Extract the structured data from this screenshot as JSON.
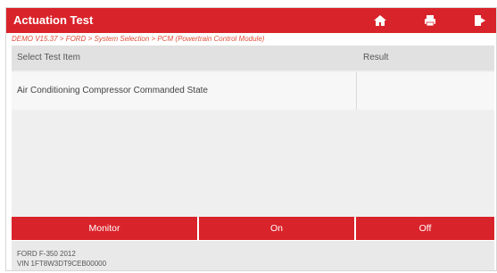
{
  "header": {
    "title": "Actuation Test",
    "icons": [
      "home-icon",
      "printer-icon",
      "exit-icon"
    ]
  },
  "breadcrumb": "DEMO V15.37 > FORD > System Selection > PCM (Powertrain Control Module)",
  "table": {
    "columns": [
      "Select Test Item",
      "Result"
    ],
    "rows": [
      {
        "item": "Air Conditioning Compressor Commanded State",
        "result": ""
      }
    ]
  },
  "buttons": {
    "monitor": "Monitor",
    "on": "On",
    "off": "Off"
  },
  "footer": {
    "vehicle": "FORD F-350 2012",
    "vin": "VIN 1FT8W3DT9CEB00000"
  },
  "colors": {
    "accent": "#d9232a",
    "breadcrumb": "#e04d3a"
  }
}
